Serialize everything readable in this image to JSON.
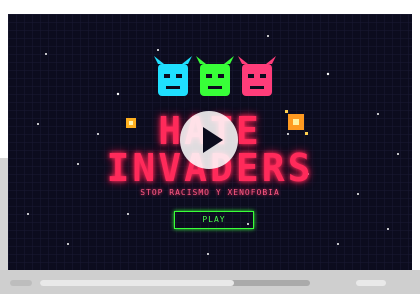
{
  "game": {
    "title_line1": "HATE",
    "title_line2": "INVADERS",
    "subtitle": "STOP RACISMO Y XENOFOBIA",
    "play_label": "PLAY"
  },
  "invaders": [
    {
      "name": "cyan-invader-icon",
      "color": "#1fe0ff"
    },
    {
      "name": "green-invader-icon",
      "color": "#38ff38"
    },
    {
      "name": "pink-invader-icon",
      "color": "#ff3d7a"
    }
  ],
  "player": {
    "progress": 0.72,
    "volume": 1.0
  },
  "colors": {
    "title": "#ff2a5a",
    "play": "#39ff39",
    "background": "#0c0c1e"
  }
}
